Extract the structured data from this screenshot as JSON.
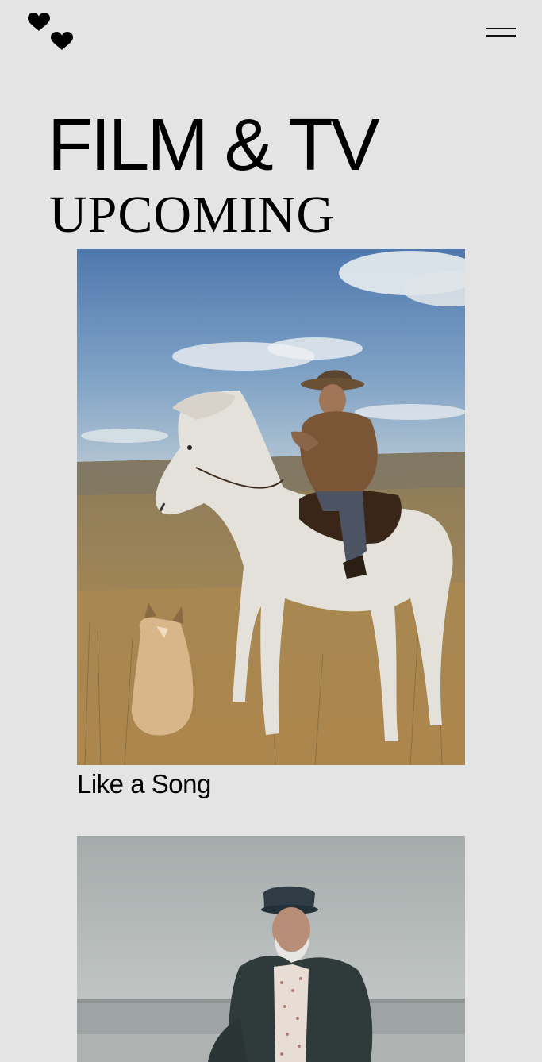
{
  "header": {
    "logo_icon": "two-hearts-logo-icon",
    "menu_icon": "hamburger-menu-icon"
  },
  "page": {
    "title": "FILM & TV",
    "section_title": "UPCOMING"
  },
  "projects": [
    {
      "title": "Like a Song",
      "image": "photo-horseman-with-white-horse-and-dog"
    },
    {
      "title": "",
      "image": "photo-old-man-in-cap-by-the-sea"
    }
  ],
  "colors": {
    "background": "#e4e4e4",
    "text": "#000000"
  }
}
